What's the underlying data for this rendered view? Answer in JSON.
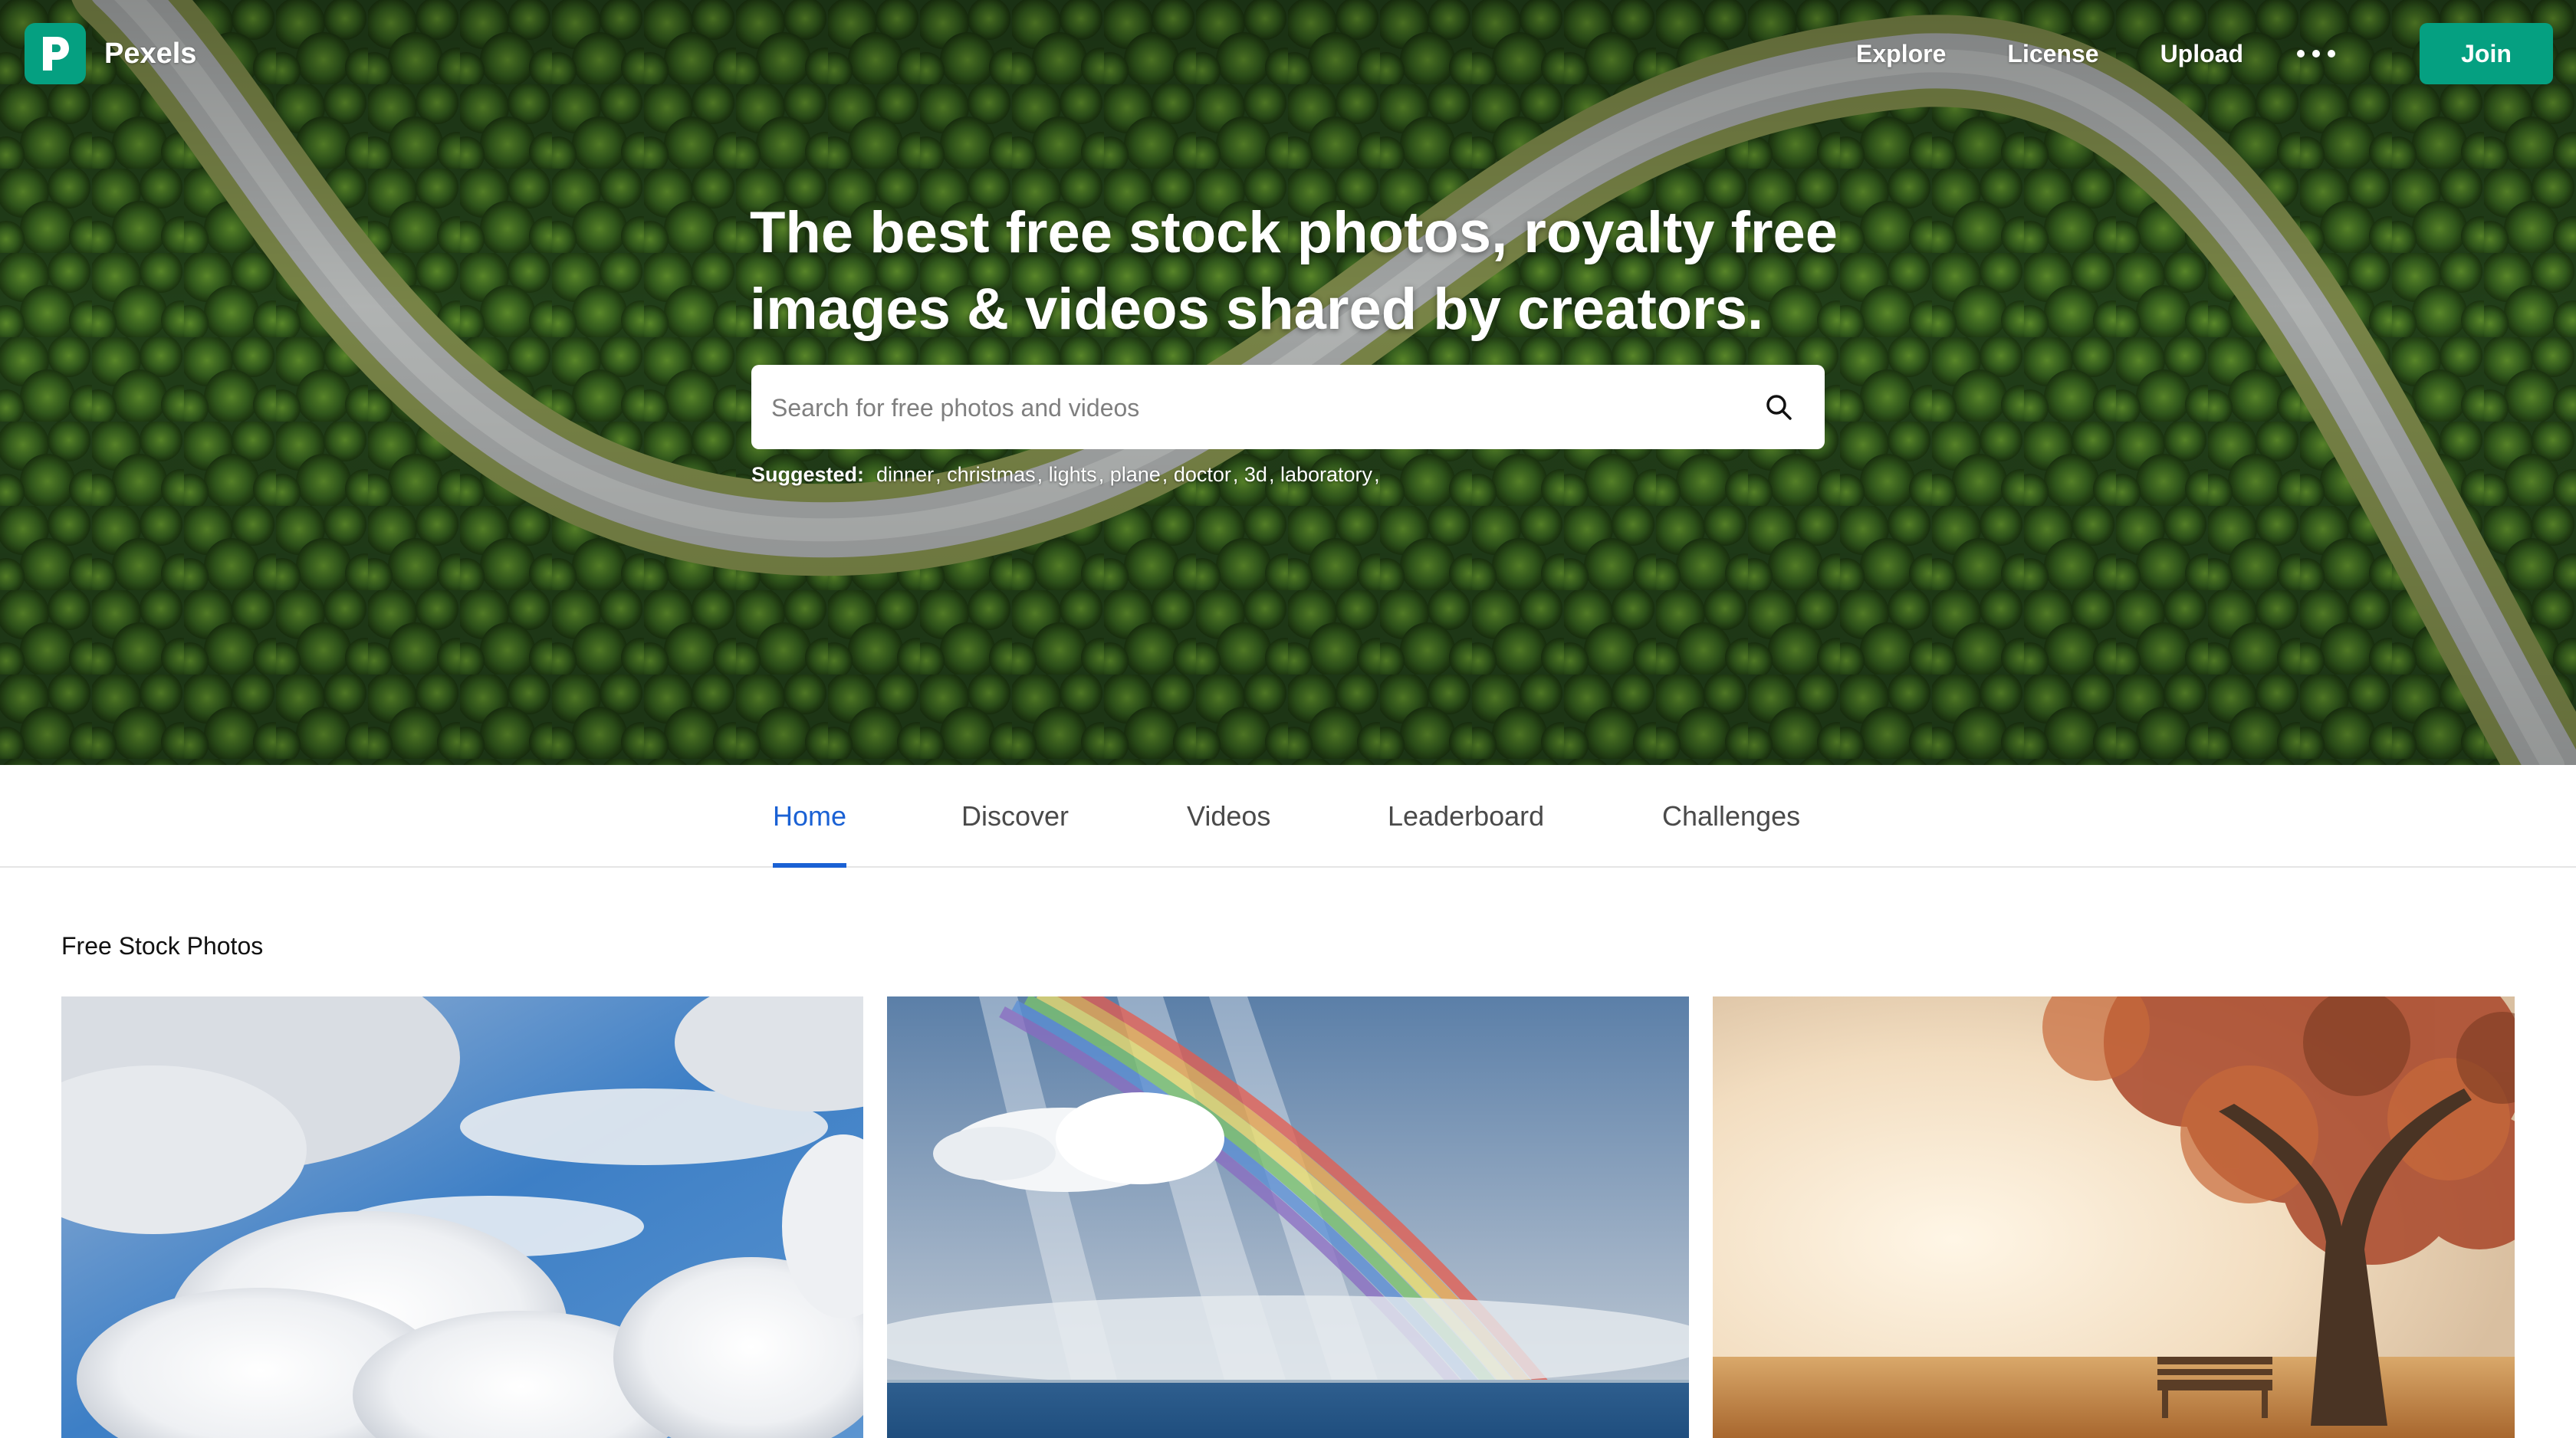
{
  "brand": {
    "name": "Pexels",
    "logo_letter": "P",
    "accent": "#05a081"
  },
  "nav": {
    "links": [
      "Explore",
      "License",
      "Upload"
    ],
    "more_label": "More",
    "join_label": "Join"
  },
  "hero": {
    "headline": "The best free stock photos, royalty free images & videos shared by creators.",
    "search_placeholder": "Search for free photos and videos",
    "suggested_label": "Suggested:",
    "suggested": [
      "dinner",
      "christmas",
      "lights",
      "plane",
      "doctor",
      "3d",
      "laboratory"
    ],
    "suggested_separator": ","
  },
  "tabs": {
    "items": [
      "Home",
      "Discover",
      "Videos",
      "Leaderboard",
      "Challenges"
    ],
    "active": "Home",
    "active_color": "#1a61d4"
  },
  "content": {
    "section_title": "Free Stock Photos",
    "photos": [
      {
        "subject": "clouds-blue-sky"
      },
      {
        "subject": "rainbow-over-sea"
      },
      {
        "subject": "autumn-tree-bench"
      }
    ]
  }
}
